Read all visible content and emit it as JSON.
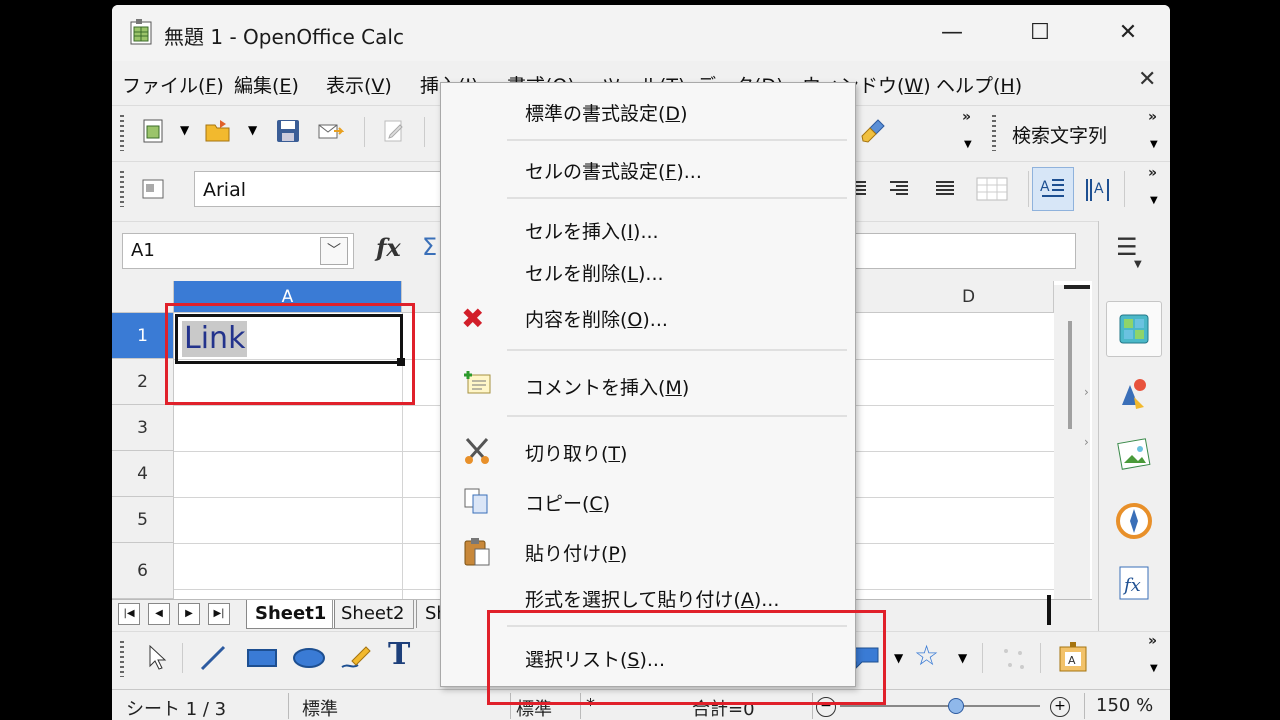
{
  "window": {
    "title": "無題 1 - OpenOffice Calc",
    "minimize": "—",
    "maximize": "☐",
    "close": "✕"
  },
  "menubar": {
    "items": [
      {
        "label": "ファイル(",
        "key": "F",
        "tail": ")"
      },
      {
        "label": "編集(",
        "key": "E",
        "tail": ")"
      },
      {
        "label": "表示(",
        "key": "V",
        "tail": ")"
      },
      {
        "label": "挿入(",
        "key": "I",
        "tail": ")"
      },
      {
        "label": "書式(",
        "key": "O",
        "tail": ")"
      },
      {
        "label": "ツール(",
        "key": "T",
        "tail": ")"
      },
      {
        "label": "データ(",
        "key": "D",
        "tail": ")"
      },
      {
        "label": "ウィンドウ(",
        "key": "W",
        "tail": ")"
      },
      {
        "label": "ヘルプ(",
        "key": "H",
        "tail": ")"
      }
    ],
    "close": "✕"
  },
  "toolbar": {
    "search_label": "検索文字列",
    "font_name": "Arial",
    "more": "»"
  },
  "formula_bar": {
    "name_box": "A1",
    "fx": "fx",
    "sum": "Σ"
  },
  "grid": {
    "columns": [
      "A",
      "D"
    ],
    "rows": [
      "1",
      "2",
      "3",
      "4",
      "5",
      "6"
    ],
    "a1_value": "Link"
  },
  "sheet_tabs": [
    "Sheet1",
    "Sheet2",
    "Sh"
  ],
  "status_bar": {
    "sheet": "シート 1 / 3",
    "style": "標準",
    "mode": "標準",
    "star": "*",
    "sum": "合計=0",
    "zoom": "150 %"
  },
  "context_menu": {
    "items": [
      {
        "label": "標準の書式設定(",
        "key": "D",
        "tail": ")"
      },
      {
        "label": "セルの書式設定(",
        "key": "F",
        "tail": ")..."
      },
      {
        "label": "セルを挿入(",
        "key": "I",
        "tail": ")..."
      },
      {
        "label": "セルを削除(",
        "key": "L",
        "tail": ")..."
      },
      {
        "label": "内容を削除(",
        "key": "O",
        "tail": ")..."
      },
      {
        "label": "コメントを挿入(",
        "key": "M",
        "tail": ")"
      },
      {
        "label": "切り取り(",
        "key": "T",
        "tail": ")"
      },
      {
        "label": "コピー(",
        "key": "C",
        "tail": ")"
      },
      {
        "label": "貼り付け(",
        "key": "P",
        "tail": ")"
      },
      {
        "label": "形式を選択して貼り付け(",
        "key": "A",
        "tail": ")..."
      },
      {
        "label": "選択リスト(",
        "key": "S",
        "tail": ")..."
      }
    ]
  },
  "colors": {
    "highlight": "#e0202a",
    "accent": "#3a7bd5",
    "cell_text": "#23338c"
  }
}
